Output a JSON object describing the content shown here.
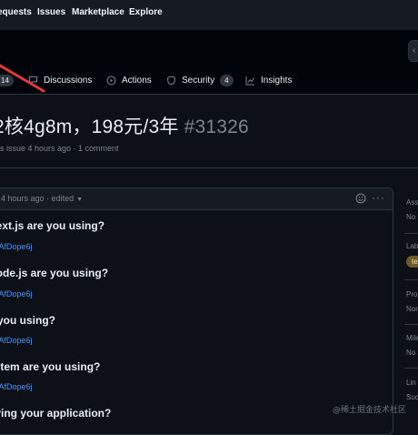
{
  "topnav": {
    "items": [
      "equests",
      "Issues",
      "Marketplace",
      "Explore"
    ]
  },
  "repo_tabs": [
    {
      "label": "",
      "count": "14"
    },
    {
      "label": "Discussions"
    },
    {
      "label": "Actions"
    },
    {
      "label": "Security",
      "count": "4"
    },
    {
      "label": "Insights"
    }
  ],
  "issue": {
    "title": "2核4g8m，198元/3年",
    "number": "#31326",
    "meta": "s issue 4 hours ago · 1 comment"
  },
  "comment": {
    "time": "4 hours ago",
    "edited": "· edited",
    "questions": [
      {
        "q": "Next.js are you using?",
        "link": "n/AfDope6j"
      },
      {
        "q": "Node.js are you using?",
        "link": "n/AfDope6j"
      },
      {
        "q": "e you using?",
        "link": "n/AfDope6j"
      },
      {
        "q": "ystem are you using?",
        "link": "n/AfDope6j"
      },
      {
        "q": "oying your application?",
        "link": ""
      }
    ]
  },
  "sidebar": {
    "sections": [
      {
        "heading": "Ass",
        "value": "No"
      },
      {
        "heading": "Lab",
        "value": ""
      },
      {
        "heading": "Pro",
        "value": "Nor"
      },
      {
        "heading": "Mile",
        "value": "No"
      },
      {
        "heading": "Lin",
        "value": "Suc"
      }
    ],
    "label_chip": "te"
  },
  "watermark": "@稀土掘金技术社区"
}
